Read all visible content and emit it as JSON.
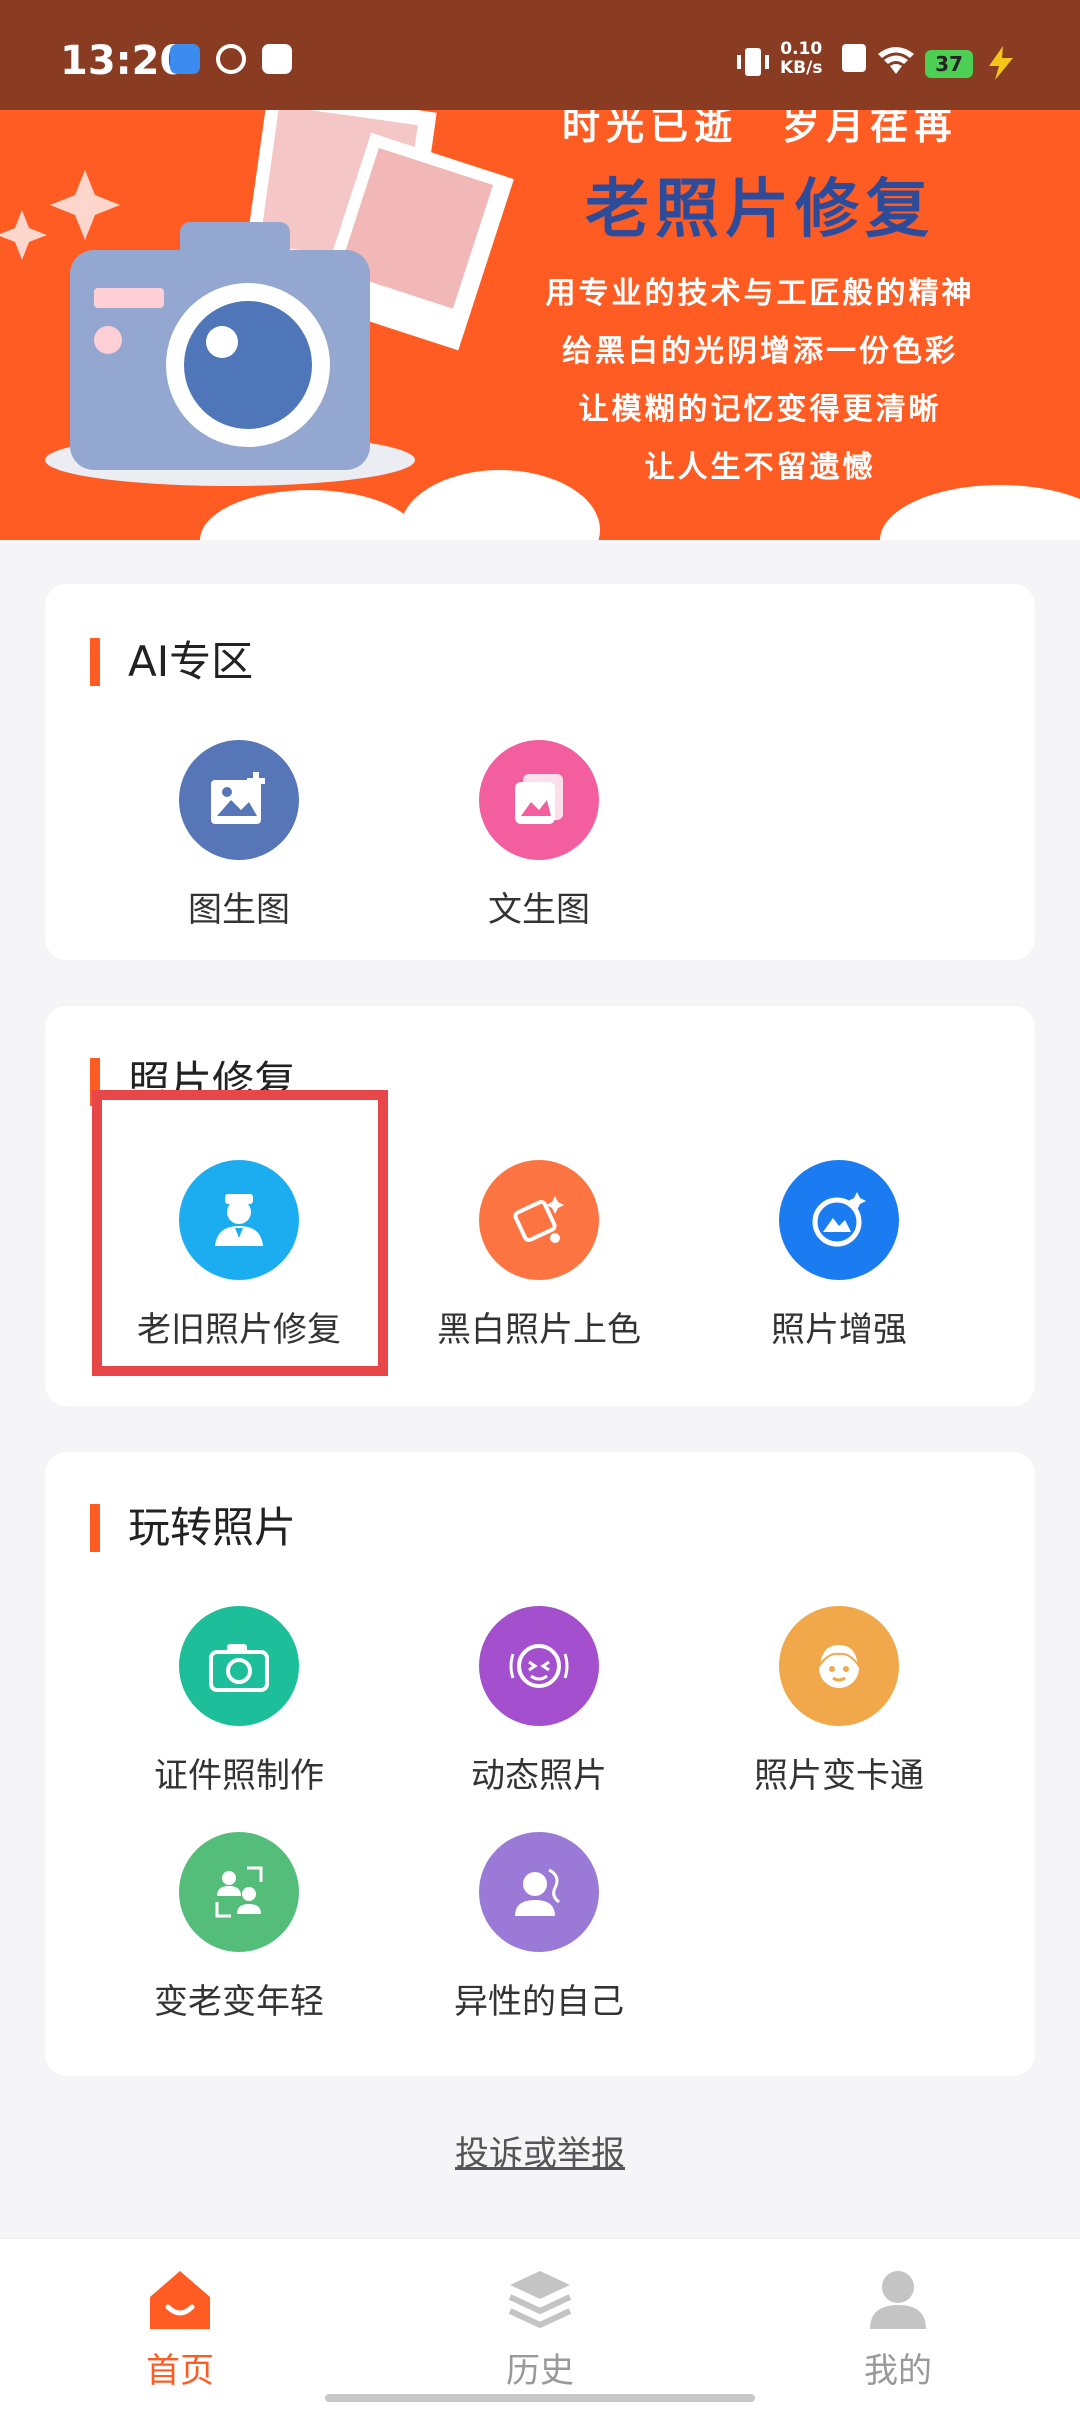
{
  "status_bar": {
    "time": "13:20",
    "speed_value": "0.10",
    "speed_unit": "KB/s",
    "battery": "37"
  },
  "banner": {
    "tagline": "时光已逝　岁月荏苒",
    "title": "老照片修复",
    "lines": [
      "用专业的技术与工匠般的精神",
      "给黑白的光阴增添一份色彩",
      "让模糊的记忆变得更清晰",
      "让人生不留遗憾"
    ]
  },
  "sections": {
    "ai": {
      "title": "AI专区",
      "items": [
        {
          "label": "图生图",
          "icon": "image-add-icon",
          "color": "#5676b8"
        },
        {
          "label": "文生图",
          "icon": "gallery-icon",
          "color": "#f35f9e"
        }
      ]
    },
    "repair": {
      "title": "照片修复",
      "items": [
        {
          "label": "老旧照片修复",
          "icon": "portrait-icon",
          "color": "#1cadf0"
        },
        {
          "label": "黑白照片上色",
          "icon": "paint-bucket-icon",
          "color": "#fd7443"
        },
        {
          "label": "照片增强",
          "icon": "enhance-photo-icon",
          "color": "#1a7cf0"
        }
      ]
    },
    "fun": {
      "title": "玩转照片",
      "items": [
        {
          "label": "证件照制作",
          "icon": "camera-icon",
          "color": "#1cbf9a"
        },
        {
          "label": "动态照片",
          "icon": "face-motion-icon",
          "color": "#a44fce"
        },
        {
          "label": "照片变卡通",
          "icon": "cartoon-face-icon",
          "color": "#f1a84a"
        },
        {
          "label": "变老变年轻",
          "icon": "age-change-icon",
          "color": "#55bd7a"
        },
        {
          "label": "异性的自己",
          "icon": "gender-swap-icon",
          "color": "#9a7ad6"
        }
      ]
    }
  },
  "report_link": "投诉或举报",
  "bottom_nav": {
    "home": "首页",
    "history": "历史",
    "mine": "我的",
    "active_color": "#fe5c23"
  }
}
